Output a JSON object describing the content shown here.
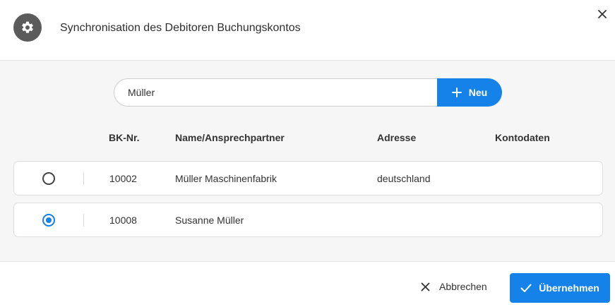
{
  "dialog": {
    "title": "Synchronisation des Debitoren Buchungskontos",
    "icon": "gear-icon",
    "close_icon": "close-icon"
  },
  "search": {
    "value": "Müller",
    "new_button_label": "Neu",
    "new_button_icon": "plus-icon"
  },
  "table": {
    "columns": [
      "BK-Nr.",
      "Name/Ansprechpartner",
      "Adresse",
      "Kontodaten"
    ],
    "rows": [
      {
        "selected": false,
        "bk_nr": "10002",
        "name": "Müller Maschinenfabrik",
        "adresse": "deutschland",
        "kontodaten": ""
      },
      {
        "selected": true,
        "bk_nr": "10008",
        "name": "Susanne Müller",
        "adresse": "",
        "kontodaten": ""
      }
    ]
  },
  "footer": {
    "cancel_label": "Abbrechen",
    "cancel_icon": "close-icon",
    "apply_label": "Übernehmen",
    "apply_icon": "check-icon"
  },
  "colors": {
    "accent": "#1482e8",
    "header_icon_bg": "#5b5b5b",
    "body_bg": "#f6f6f6"
  }
}
